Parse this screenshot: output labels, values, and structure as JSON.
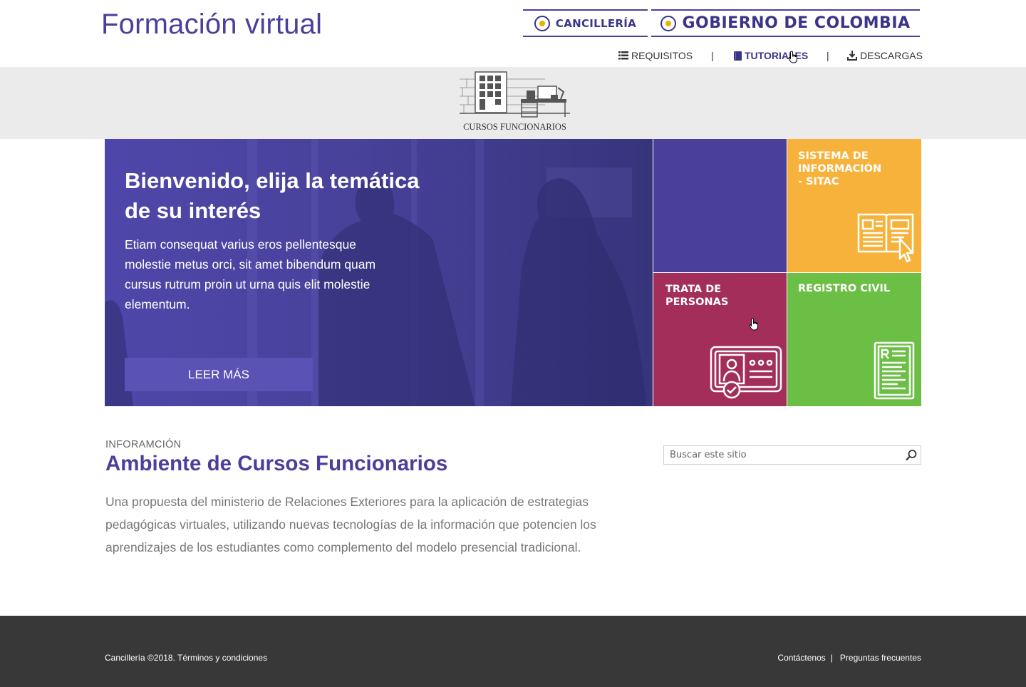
{
  "header": {
    "site_title": "Formación virtual",
    "cancilleria_label": "CANCILLERÍA",
    "gobierno_label": "GOBIERNO DE COLOMBIA"
  },
  "nav": {
    "items": [
      {
        "label": "REQUISITOS",
        "icon": "list-icon"
      },
      {
        "label": "TUTORIALES",
        "icon": "book-icon",
        "active": true
      },
      {
        "label": "DESCARGAS",
        "icon": "download-icon"
      }
    ],
    "separator": "|"
  },
  "logo": {
    "caption": "CURSOS FUNCIONARIOS"
  },
  "hero": {
    "title": "Bienvenido, elija la temática de su interés",
    "text": "Etiam consequat varius eros pellentesque molestie metus orci, sit amet bibendum quam cursus rutrum proin ut urna quis elit molestie elementum.",
    "button_label": "LEER MÁS"
  },
  "tiles": {
    "sitac_line1": "SISTEMA DE",
    "sitac_line2": "INFORMACIÓN",
    "sitac_line3": "- SITAC",
    "trata_line1": "TRATA DE",
    "trata_line2": "PERSONAS",
    "registro": "REGISTRO CIVIL"
  },
  "info": {
    "kicker": "INFORAMCIÓN",
    "title": "Ambiente de Cursos Funcionarios",
    "body": "Una propuesta del ministerio de Relaciones Exteriores para la aplicación de estrategias pedagógicas virtuales, utilizando nuevas tecnologías de la información que potencien los aprendizajes de los estudiantes como complemento del modelo presencial tradicional."
  },
  "search": {
    "placeholder": "Buscar este sitio"
  },
  "footer": {
    "copyright": "Cancillería ©2018. Términos y condiciones",
    "contact": "Contáctenos",
    "separator": "|",
    "faq": "Preguntas frecuentes"
  },
  "colors": {
    "brand_purple": "#4a3f9a",
    "orange": "#f7b23b",
    "maroon": "#a32e5a",
    "green": "#6cbf45",
    "footer": "#383838"
  }
}
